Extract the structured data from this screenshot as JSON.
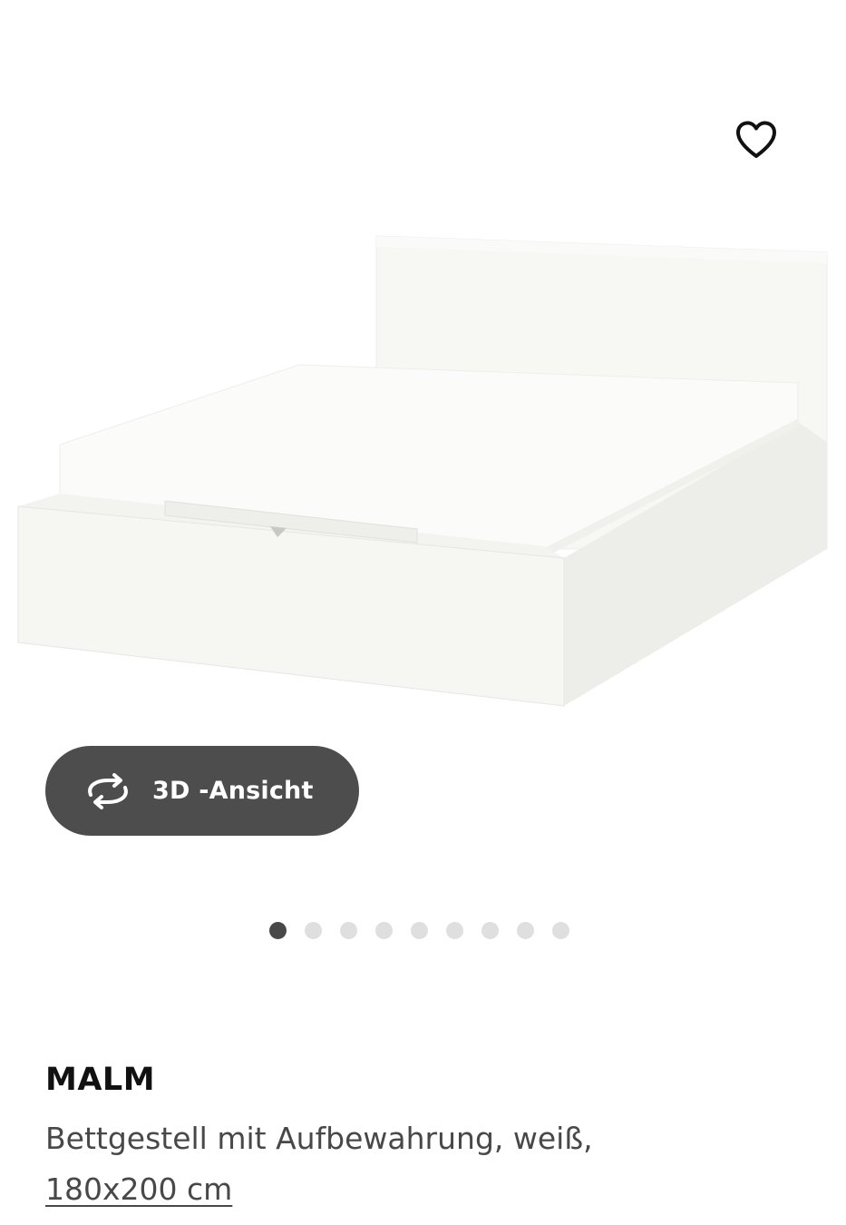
{
  "header": {
    "favorite_icon": "heart-outline-icon"
  },
  "gallery": {
    "image_subject": "white bed frame with storage",
    "view_3d": {
      "icon": "rotate-arrows-icon",
      "label": "3D -Ansicht"
    },
    "dots": {
      "count": 9,
      "active_index": 0
    }
  },
  "product": {
    "name": "MALM",
    "description": "Bettgestell mit Aufbewahrung, weiß,",
    "size": "180x200 cm"
  },
  "colors": {
    "button_bg": "#4d4d4d",
    "dot_active": "#484848",
    "dot_inactive": "#dfdfdf",
    "text_primary": "#111111",
    "text_secondary": "#484848"
  }
}
